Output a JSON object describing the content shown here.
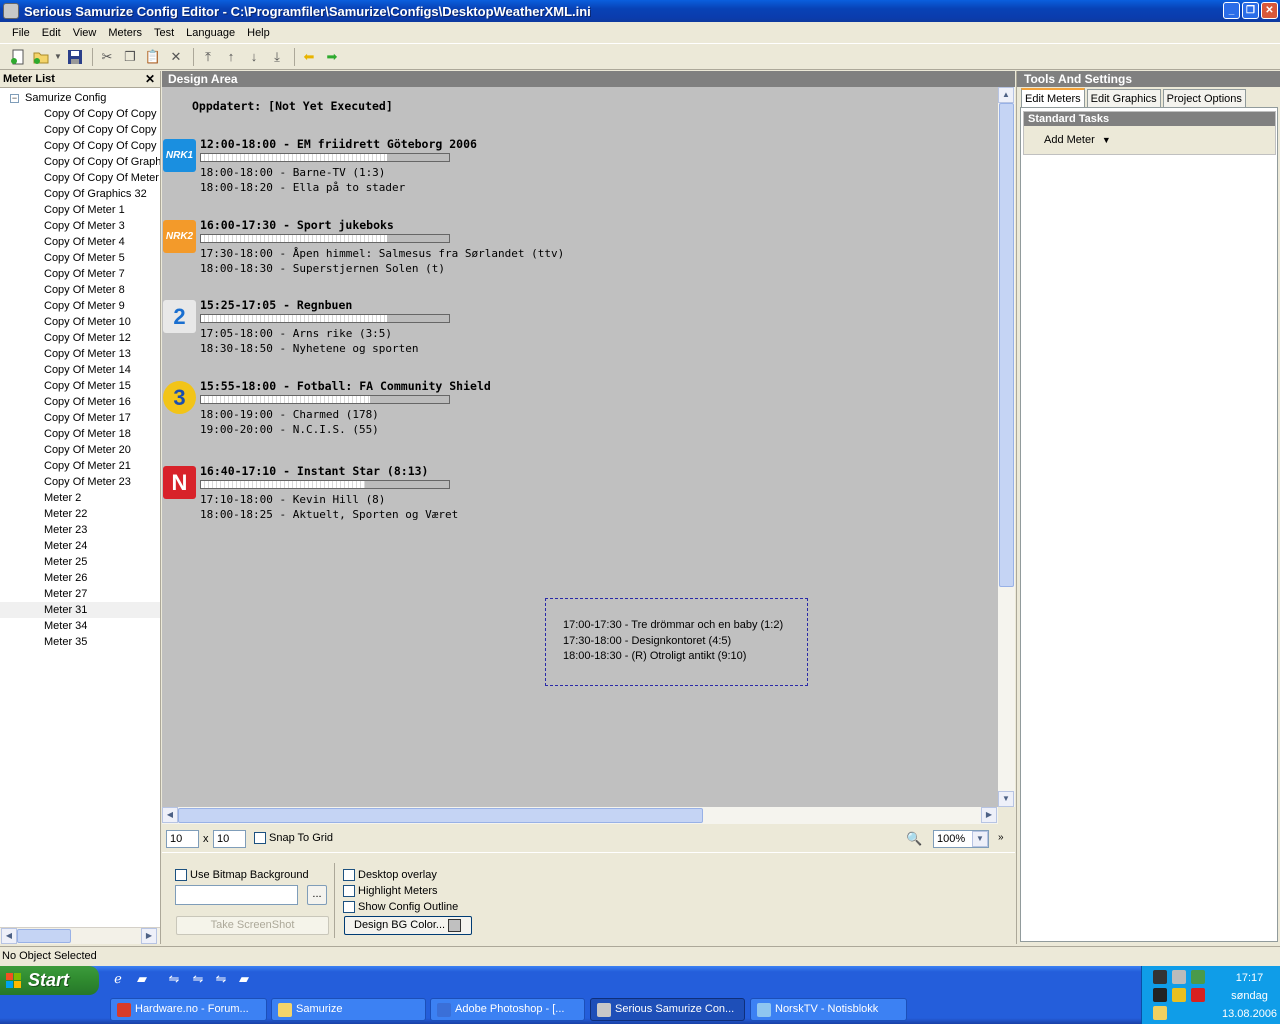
{
  "window": {
    "title": "Serious Samurize Config Editor - C:\\Programfiler\\Samurize\\Configs\\DesktopWeatherXML.ini"
  },
  "menu": [
    "File",
    "Edit",
    "View",
    "Meters",
    "Test",
    "Language",
    "Help"
  ],
  "meter_list": {
    "title": "Meter List",
    "root": "Samurize Config",
    "items": [
      "Copy Of Copy Of Copy",
      "Copy Of Copy Of Copy",
      "Copy Of Copy Of Copy",
      "Copy Of Copy Of Graph",
      "Copy Of Copy Of Meter",
      "Copy Of Graphics 32",
      "Copy Of Meter 1",
      "Copy Of Meter 3",
      "Copy Of Meter 4",
      "Copy Of Meter 5",
      "Copy Of Meter 7",
      "Copy Of Meter 8",
      "Copy Of Meter 9",
      "Copy Of Meter 10",
      "Copy Of Meter 12",
      "Copy Of Meter 13",
      "Copy Of Meter 14",
      "Copy Of Meter 15",
      "Copy Of Meter 16",
      "Copy Of Meter 17",
      "Copy Of Meter 18",
      "Copy Of Meter 20",
      "Copy Of Meter 21",
      "Copy Of Meter 23",
      "Meter 2",
      "Meter 22",
      "Meter 23",
      "Meter 24",
      "Meter 25",
      "Meter 26",
      "Meter 27",
      "Meter 31",
      "Meter 34",
      "Meter 35"
    ],
    "selected_index": 31
  },
  "design_area": {
    "title": "Design Area",
    "updated": "Oppdatert:  [Not Yet Executed]",
    "channels": [
      {
        "logo": "NRK1",
        "logo_color": "#1a8fe0",
        "now": "12:00-18:00 - EM friidrett Göteborg 2006",
        "progress": 0.75,
        "next1": "18:00-18:00 - Barne-TV (1:3)",
        "next2": "18:00-18:20 - Ella på to stader"
      },
      {
        "logo": "NRK2",
        "logo_color": "#f39a2a",
        "now": "16:00-17:30 - Sport jukeboks",
        "progress": 0.75,
        "next1": "17:30-18:00 - Åpen himmel: Salmesus fra Sørlandet (ttv)",
        "next2": "18:00-18:30 - Superstjernen Solen (t)"
      },
      {
        "logo": "2",
        "logo_color": "#e8e8e8",
        "now": "15:25-17:05 - Regnbuen",
        "progress": 0.75,
        "next1": "17:05-18:00 - Arns rike (3:5)",
        "next2": "18:30-18:50 - Nyhetene og sporten"
      },
      {
        "logo": "3",
        "logo_color": "#f2c418",
        "now": "15:55-18:00 - Fotball: FA Community Shield",
        "progress": 0.68,
        "next1": "18:00-19:00 - Charmed (178)",
        "next2": "19:00-20:00 - N.C.I.S. (55)"
      },
      {
        "logo": "N",
        "logo_color": "#d8222a",
        "now": "16:40-17:10 - Instant Star (8:13)",
        "progress": 0.66,
        "next1": "17:10-18:00 - Kevin Hill (8)",
        "next2": "18:00-18:25 - Aktuelt, Sporten og Været"
      }
    ],
    "selected_meter_lines": [
      "17:00-17:30 - Tre drömmar och en baby (1:2)",
      "17:30-18:00 - Designkontoret (4:5)",
      "18:00-18:30 - (R) Otroligt antikt (9:10)"
    ]
  },
  "grid": {
    "width": "10",
    "x": "x",
    "height": "10",
    "snap_label": "Snap To Grid",
    "zoom": "100%"
  },
  "bottom": {
    "use_bitmap_label": "Use Bitmap Background",
    "browse_label": "...",
    "screenshot_label": "Take ScreenShot",
    "desktop_overlay": "Desktop overlay",
    "highlight_meters": "Highlight Meters",
    "show_outline": "Show Config Outline",
    "bg_color_label": "Design BG Color..."
  },
  "tools": {
    "title": "Tools And Settings",
    "tabs": [
      "Edit Meters",
      "Edit Graphics",
      "Project Options"
    ],
    "standard_tasks": "Standard Tasks",
    "add_meter": "Add Meter"
  },
  "status": "No Object Selected",
  "taskbar": {
    "start": "Start",
    "tasks": [
      "Hardware.no - Forum...",
      "Samurize",
      "Adobe Photoshop - [...",
      "Serious Samurize Con...",
      "NorskTV - Notisblokk"
    ],
    "time": "17:17",
    "day": "søndag",
    "date": "13.08.2006"
  }
}
